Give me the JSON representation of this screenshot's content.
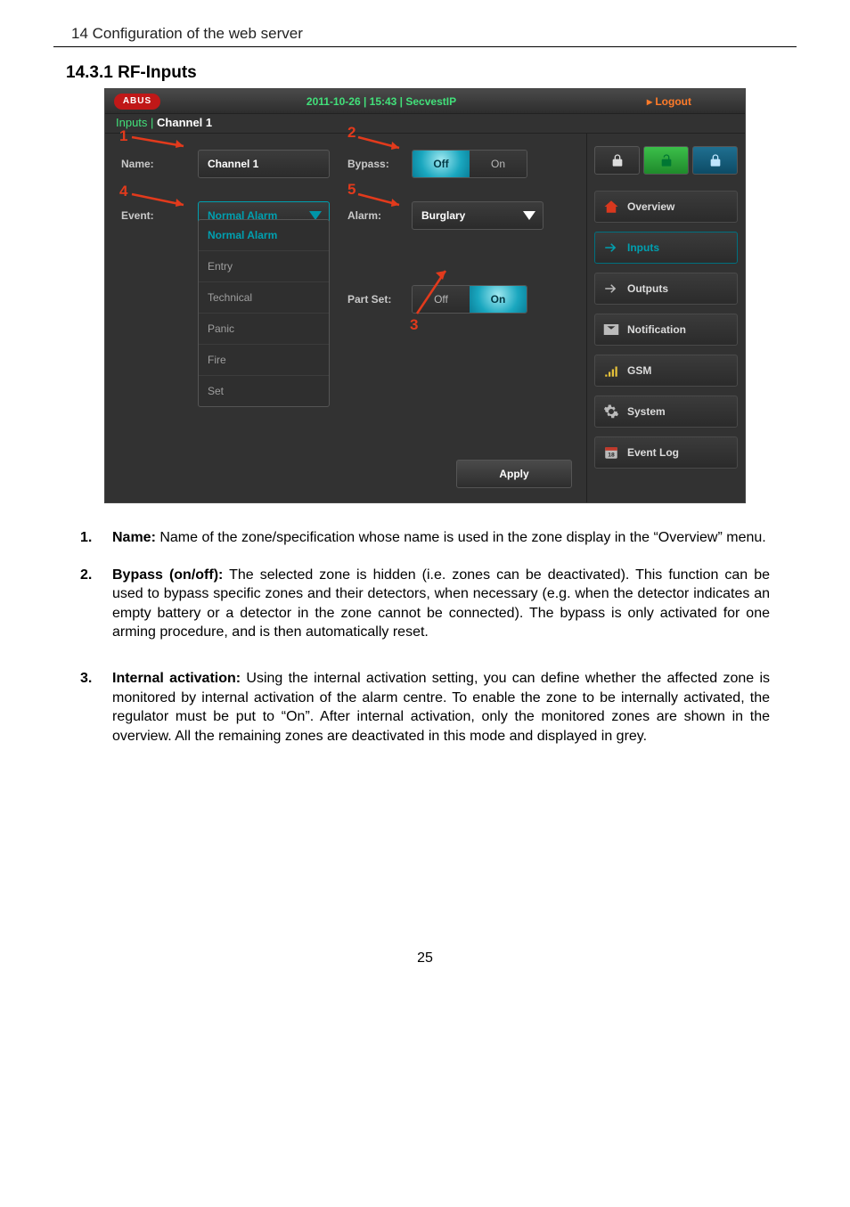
{
  "chapter_header": "14  Configuration of the web server",
  "section_title": "14.3.1 RF-Inputs",
  "top": {
    "logo": "ABUS",
    "datetime": "2011-10-26  |  15:43  |  SecvestIP",
    "logout": "Logout"
  },
  "breadcrumb": {
    "prefix": "Inputs | ",
    "current": "Channel 1"
  },
  "form": {
    "name_label": "Name:",
    "name_value": "Channel 1",
    "bypass_label": "Bypass:",
    "bypass_off": "Off",
    "bypass_on": "On",
    "bypass_state": "off",
    "event_label": "Event:",
    "event_value": "Normal Alarm",
    "event_options": [
      "Normal Alarm",
      "Entry",
      "Technical",
      "Panic",
      "Fire",
      "Set"
    ],
    "alarm_label": "Alarm:",
    "alarm_value": "Burglary",
    "partset_label": "Part Set:",
    "partset_off": "Off",
    "partset_on": "On",
    "partset_state": "on",
    "apply": "Apply"
  },
  "side": {
    "nav": [
      {
        "key": "overview",
        "label": "Overview"
      },
      {
        "key": "inputs",
        "label": "Inputs"
      },
      {
        "key": "outputs",
        "label": "Outputs"
      },
      {
        "key": "notification",
        "label": "Notification"
      },
      {
        "key": "gsm",
        "label": "GSM"
      },
      {
        "key": "system",
        "label": "System"
      },
      {
        "key": "eventlog",
        "label": "Event Log"
      }
    ]
  },
  "annotations": {
    "n1": "1",
    "n2": "2",
    "n3": "3",
    "n4": "4",
    "n5": "5"
  },
  "descriptions": [
    {
      "num": "1.",
      "bold": "Name:",
      "text": " Name of the zone/specification whose name is used in the zone display in the “Overview” menu."
    },
    {
      "num": "2.",
      "bold": "Bypass (on/off):",
      "text": " The selected zone is hidden (i.e. zones can be deactivated). This function can be used to bypass specific zones and their detectors, when necessary (e.g. when the detector indicates an empty battery or a detector in the zone cannot be connected). The bypass is only activated for one arming procedure, and is then automatically reset."
    },
    {
      "num": "3.",
      "bold": "Internal activation:",
      "text": " Using the internal activation setting, you can define whether the affected zone is monitored by internal activation of the alarm centre. To enable the zone to be internally activated, the regulator must be put to “On”. After internal activation, only the monitored zones are shown in the overview. All the remaining zones are deactivated in this mode and displayed in grey."
    }
  ],
  "page_number": "25"
}
